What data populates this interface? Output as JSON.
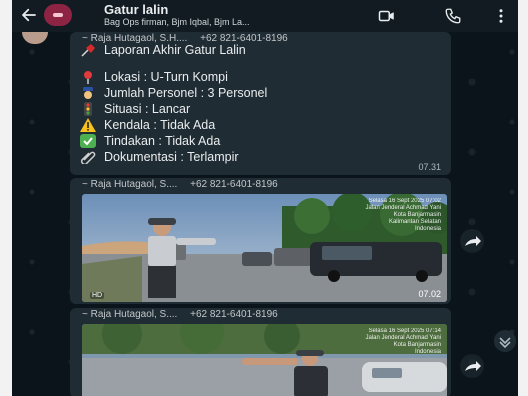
{
  "header": {
    "title": "Gatur lalin",
    "subtitle": "Bag Ops firman, Bjm Iqbal, Bjm La..."
  },
  "messages": [
    {
      "sender": "~ Raja Hutagaol, S.H....",
      "phone": "+62 821-6401-8196",
      "title_line": "Laporan Akhir Gatur Lalin",
      "lines": [
        "Lokasi : U-Turn Kompi",
        "Jumlah Personel : 3 Personel",
        "Situasi : Lancar",
        "Kendala : Tidak Ada",
        "Tindakan : Tidak Ada",
        "Dokumentasi : Terlampir"
      ],
      "time": "07.31"
    },
    {
      "sender": "~ Raja Hutagaol, S....",
      "phone": "+62 821-6401-8196",
      "photo_stamp": [
        "Selasa 16 Sept 2025 07:02",
        "Jalan Jenderal Achmad Yani",
        "Kota Banjarmasin",
        "Kalimantan Selatan",
        "Indonesia"
      ],
      "hd": "HD",
      "time": "07.02"
    },
    {
      "sender": "~ Raja Hutagaol, S....",
      "phone": "+62 821-6401-8196",
      "photo_stamp": [
        "Selasa 16 Sept 2025 07:14",
        "Jalan Jenderal Achmad Yani",
        "Kota Banjarmasin",
        "Indonesia"
      ]
    }
  ],
  "icons": {
    "back": "arrow-left-icon",
    "video": "video-camera-icon",
    "call": "phone-icon",
    "menu": "kebab-menu-icon",
    "forward": "forward-icon",
    "scroll": "chevron-down-icon"
  }
}
